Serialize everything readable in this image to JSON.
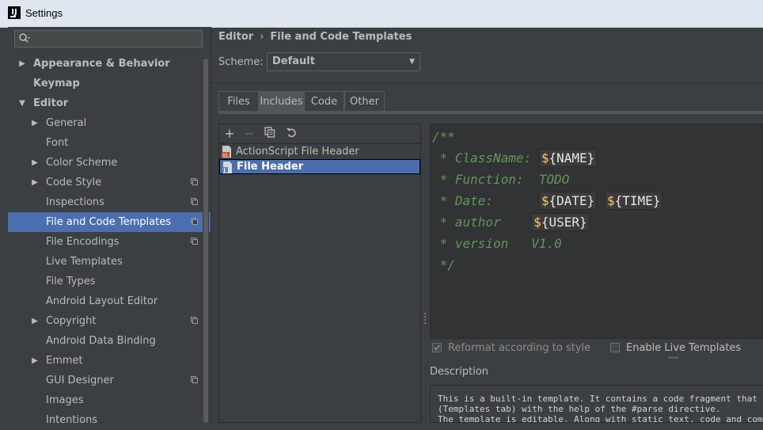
{
  "window": {
    "title": "Settings"
  },
  "sidebar": {
    "search_placeholder": "",
    "items": [
      {
        "label": "Appearance & Behavior",
        "level": 0,
        "arrow": "right",
        "bold": true,
        "copy": false,
        "selected": false
      },
      {
        "label": "Keymap",
        "level": 0,
        "arrow": "none",
        "bold": true,
        "copy": false,
        "selected": false
      },
      {
        "label": "Editor",
        "level": 0,
        "arrow": "down",
        "bold": true,
        "copy": false,
        "selected": false
      },
      {
        "label": "General",
        "level": 1,
        "arrow": "right",
        "bold": false,
        "copy": false,
        "selected": false
      },
      {
        "label": "Font",
        "level": 1,
        "arrow": "none",
        "bold": false,
        "copy": false,
        "selected": false
      },
      {
        "label": "Color Scheme",
        "level": 1,
        "arrow": "right",
        "bold": false,
        "copy": false,
        "selected": false
      },
      {
        "label": "Code Style",
        "level": 1,
        "arrow": "right",
        "bold": false,
        "copy": true,
        "selected": false
      },
      {
        "label": "Inspections",
        "level": 1,
        "arrow": "none",
        "bold": false,
        "copy": true,
        "selected": false
      },
      {
        "label": "File and Code Templates",
        "level": 1,
        "arrow": "none",
        "bold": false,
        "copy": true,
        "selected": true
      },
      {
        "label": "File Encodings",
        "level": 1,
        "arrow": "none",
        "bold": false,
        "copy": true,
        "selected": false
      },
      {
        "label": "Live Templates",
        "level": 1,
        "arrow": "none",
        "bold": false,
        "copy": false,
        "selected": false
      },
      {
        "label": "File Types",
        "level": 1,
        "arrow": "none",
        "bold": false,
        "copy": false,
        "selected": false
      },
      {
        "label": "Android Layout Editor",
        "level": 1,
        "arrow": "none",
        "bold": false,
        "copy": false,
        "selected": false
      },
      {
        "label": "Copyright",
        "level": 1,
        "arrow": "right",
        "bold": false,
        "copy": true,
        "selected": false
      },
      {
        "label": "Android Data Binding",
        "level": 1,
        "arrow": "none",
        "bold": false,
        "copy": false,
        "selected": false
      },
      {
        "label": "Emmet",
        "level": 1,
        "arrow": "right",
        "bold": false,
        "copy": false,
        "selected": false
      },
      {
        "label": "GUI Designer",
        "level": 1,
        "arrow": "none",
        "bold": false,
        "copy": true,
        "selected": false
      },
      {
        "label": "Images",
        "level": 1,
        "arrow": "none",
        "bold": false,
        "copy": false,
        "selected": false
      },
      {
        "label": "Intentions",
        "level": 1,
        "arrow": "none",
        "bold": false,
        "copy": false,
        "selected": false
      }
    ]
  },
  "breadcrumb": {
    "parent": "Editor",
    "separator": "›",
    "current": "File and Code Templates"
  },
  "scheme": {
    "label": "Scheme:",
    "value": "Default"
  },
  "tabs": [
    {
      "label": "Files",
      "active": false
    },
    {
      "label": "Includes",
      "active": true
    },
    {
      "label": "Code",
      "active": false
    },
    {
      "label": "Other",
      "active": false
    }
  ],
  "templates": [
    {
      "label": "ActionScript File Header",
      "icon": "actionscript-file-icon",
      "selected": false
    },
    {
      "label": "File Header",
      "icon": "java-file-icon",
      "selected": true
    }
  ],
  "editor": {
    "lines": [
      {
        "text": "/**"
      },
      {
        "text": " * ClassName: ",
        "vars": [
          "NAME"
        ]
      },
      {
        "text": " * Function:  TODO"
      },
      {
        "text": " * Date:      ",
        "vars": [
          "DATE",
          "TIME"
        ]
      },
      {
        "text": " * author    ",
        "vars": [
          "USER"
        ]
      },
      {
        "text": " * version   V1.0"
      },
      {
        "text": " */"
      }
    ]
  },
  "options": {
    "reformat": {
      "label": "Reformat according to style",
      "checked": true
    },
    "live_templates": {
      "label": "Enable Live Templates",
      "checked": false
    }
  },
  "description": {
    "label": "Description",
    "lines": [
      "This is a built-in template. It contains a code fragment that can be include",
      "(Templates tab) with the help of the #parse directive.",
      "The template is editable. Along with static text, code and comments, you"
    ]
  },
  "colors": {
    "accent": "#4b6eaf",
    "background": "#3c3f41",
    "editor_bg": "#313335",
    "comment": "#629755",
    "variable": "#ffc66d"
  }
}
